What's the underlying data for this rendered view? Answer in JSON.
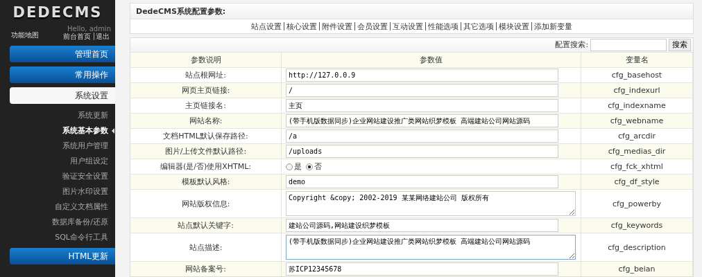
{
  "sidebar": {
    "logo": "DEDECMS",
    "map_link": "功能地图",
    "greeting": "Hello, admin",
    "user_links": [
      "前台首页",
      "退出"
    ],
    "sections": [
      {
        "label": "管理首页",
        "expanded": false
      },
      {
        "label": "常用操作",
        "expanded": false
      },
      {
        "label": "系统设置",
        "expanded": true,
        "children": [
          {
            "label": "系统更新",
            "selected": false
          },
          {
            "label": "系统基本参数",
            "selected": true
          },
          {
            "label": "系统用户管理",
            "selected": false
          },
          {
            "label": "用户组设定",
            "selected": false
          },
          {
            "label": "验证安全设置",
            "selected": false
          },
          {
            "label": "图片水印设置",
            "selected": false
          },
          {
            "label": "自定义文档属性",
            "selected": false
          },
          {
            "label": "数据库备份/还原",
            "selected": false
          },
          {
            "label": "SQL命令行工具",
            "selected": false
          }
        ]
      },
      {
        "label": "HTML更新",
        "expanded": false
      }
    ]
  },
  "panel": {
    "title": "DedeCMS系统配置参数:",
    "tabs": [
      "站点设置",
      "核心设置",
      "附件设置",
      "会员设置",
      "互动设置",
      "性能选项",
      "其它选项",
      "模块设置",
      "添加新变量"
    ]
  },
  "search": {
    "label": "配置搜索:",
    "button": "搜索"
  },
  "table": {
    "columns": [
      "参数说明",
      "参数值",
      "变量名"
    ],
    "rows": [
      {
        "label": "站点根网址:",
        "kind": "text",
        "value": "http://127.0.0.9",
        "var": "cfg_basehost"
      },
      {
        "label": "网页主页链接:",
        "kind": "text",
        "value": "/",
        "var": "cfg_indexurl"
      },
      {
        "label": "主页链接名:",
        "kind": "text",
        "value": "主页",
        "var": "cfg_indexname"
      },
      {
        "label": "网站名称:",
        "kind": "text",
        "value": "(带手机版数据同步)企业网站建设推广类网站织梦模板 高端建站公司网站源码",
        "var": "cfg_webname"
      },
      {
        "label": "文档HTML默认保存路径:",
        "kind": "text",
        "value": "/a",
        "var": "cfg_arcdir"
      },
      {
        "label": "图片/上传文件默认路径:",
        "kind": "text",
        "value": "/uploads",
        "var": "cfg_medias_dir"
      },
      {
        "label": "编辑器(是/否)使用XHTML:",
        "kind": "radio",
        "options": [
          {
            "label": "是",
            "selected": false
          },
          {
            "label": "否",
            "selected": true
          }
        ],
        "var": "cfg_fck_xhtml"
      },
      {
        "label": "模板默认风格:",
        "kind": "text",
        "value": "demo",
        "var": "cfg_df_style"
      },
      {
        "label": "网站版权信息:",
        "kind": "textarea",
        "value": "Copyright &copy; 2002-2019 某某网络建站公司 版权所有",
        "var": "cfg_powerby"
      },
      {
        "label": "站点默认关键字:",
        "kind": "text",
        "value": "建站公司源码,网站建设织梦模板",
        "var": "cfg_keywords"
      },
      {
        "label": "站点描述:",
        "kind": "textarea",
        "value": "(带手机版数据同步)企业网站建设推广类网站织梦模板 高端建站公司网站源码",
        "var": "cfg_description"
      },
      {
        "label": "网站备案号:",
        "kind": "text",
        "value": "苏ICP12345678",
        "var": "cfg_beian"
      }
    ]
  }
}
